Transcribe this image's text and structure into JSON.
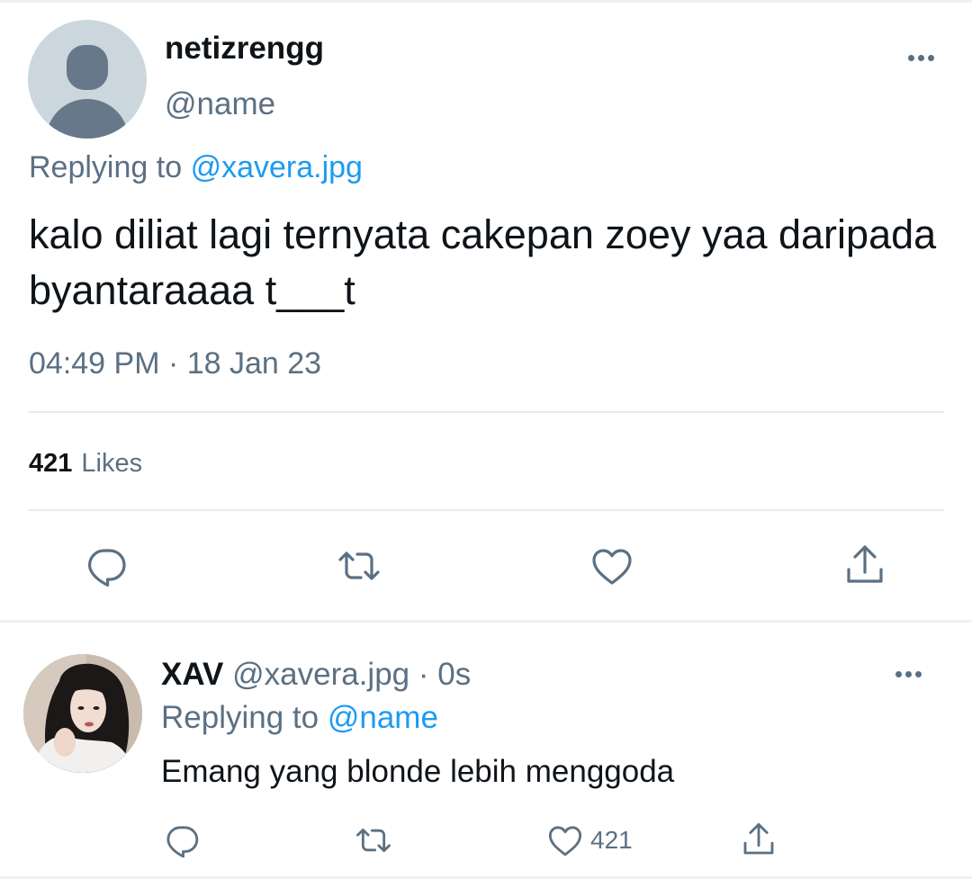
{
  "main_tweet": {
    "display_name": "netizrengg",
    "handle": "@name",
    "replying_prefix": "Replying to",
    "replying_to": "@xavera.jpg",
    "text": "kalo diliat lagi ternyata cakepan zoey yaa daripada byantaraaaa t___t",
    "timestamp": "04:49 PM · 18 Jan 23",
    "likes_count": "421",
    "likes_label": "Likes",
    "actions": {
      "reply_icon": "reply-icon",
      "retweet_icon": "retweet-icon",
      "like_icon": "heart-icon",
      "share_icon": "share-icon"
    }
  },
  "reply_tweet": {
    "display_name": "XAV",
    "meta": "@xavera.jpg · 0s",
    "replying_prefix": "Replying to",
    "replying_to": "@name",
    "text": "Emang yang blonde lebih menggoda",
    "like_count": "421"
  },
  "colors": {
    "text_primary": "#0f1419",
    "text_secondary": "#5b7083",
    "link": "#1d9bf0",
    "divider": "#e6ecf0",
    "avatar_placeholder_bg": "#ccd6dd",
    "avatar_placeholder_fg": "#66788a"
  }
}
